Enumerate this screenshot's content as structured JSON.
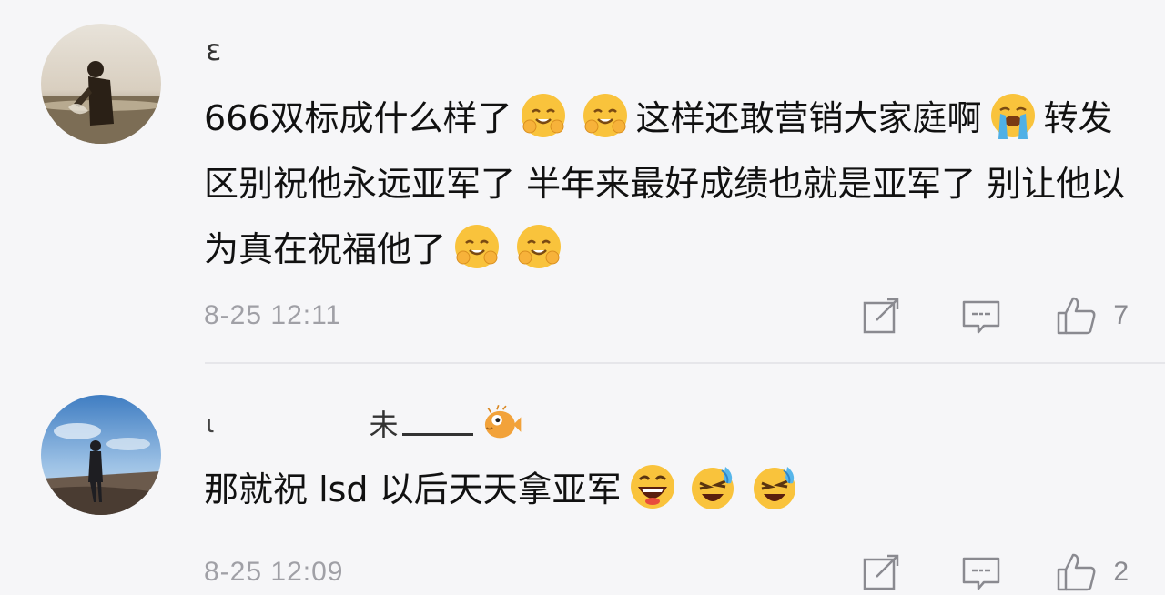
{
  "comments": [
    {
      "username": "ε",
      "text_parts": [
        "666双标成什么样了",
        "这样还敢营销大家庭啊",
        "转发区别祝他永远亚军了 半年来最好成绩也就是亚军了 别让他以为真在祝福他了"
      ],
      "time": "8-25 12:11",
      "likes": "7"
    },
    {
      "username_start": "ι",
      "username_mid": "未",
      "text": "那就祝 lsd 以后天天拿亚军",
      "time": "8-25 12:09",
      "likes": "2"
    }
  ],
  "icons": {
    "share": "share-icon",
    "reply": "comment-icon",
    "like": "thumbs-up-icon"
  },
  "colors": {
    "background": "#f6f6f8",
    "meta_text": "#a0a0a6",
    "divider": "#e6e6ea"
  }
}
